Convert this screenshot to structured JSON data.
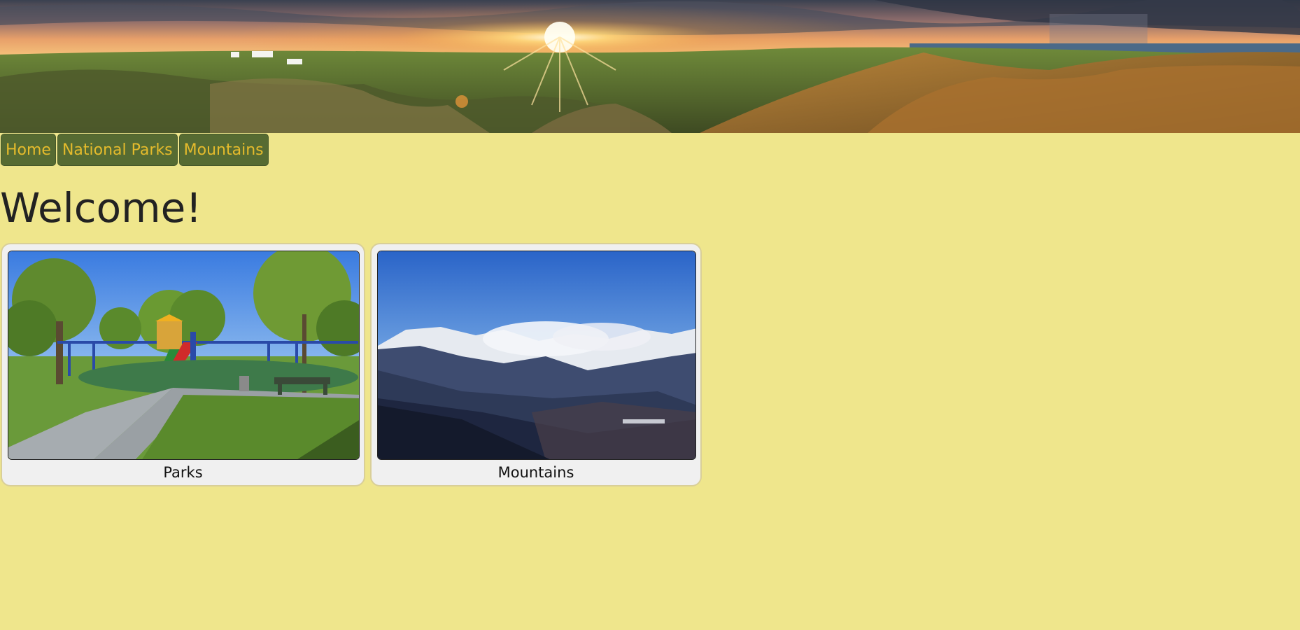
{
  "banner": {
    "image": "sunset-dunes-landscape"
  },
  "nav": {
    "items": [
      {
        "label": "Home"
      },
      {
        "label": "National Parks"
      },
      {
        "label": "Mountains"
      }
    ]
  },
  "main": {
    "title": "Welcome!",
    "cards": [
      {
        "caption": "Parks",
        "image": "park-playground-photo"
      },
      {
        "caption": "Mountains",
        "image": "snowy-mountains-photo"
      }
    ]
  },
  "colors": {
    "background": "#efe68c",
    "nav_button": "#566b32",
    "nav_text": "#e5bb2c",
    "card": "#f0f0f0"
  }
}
